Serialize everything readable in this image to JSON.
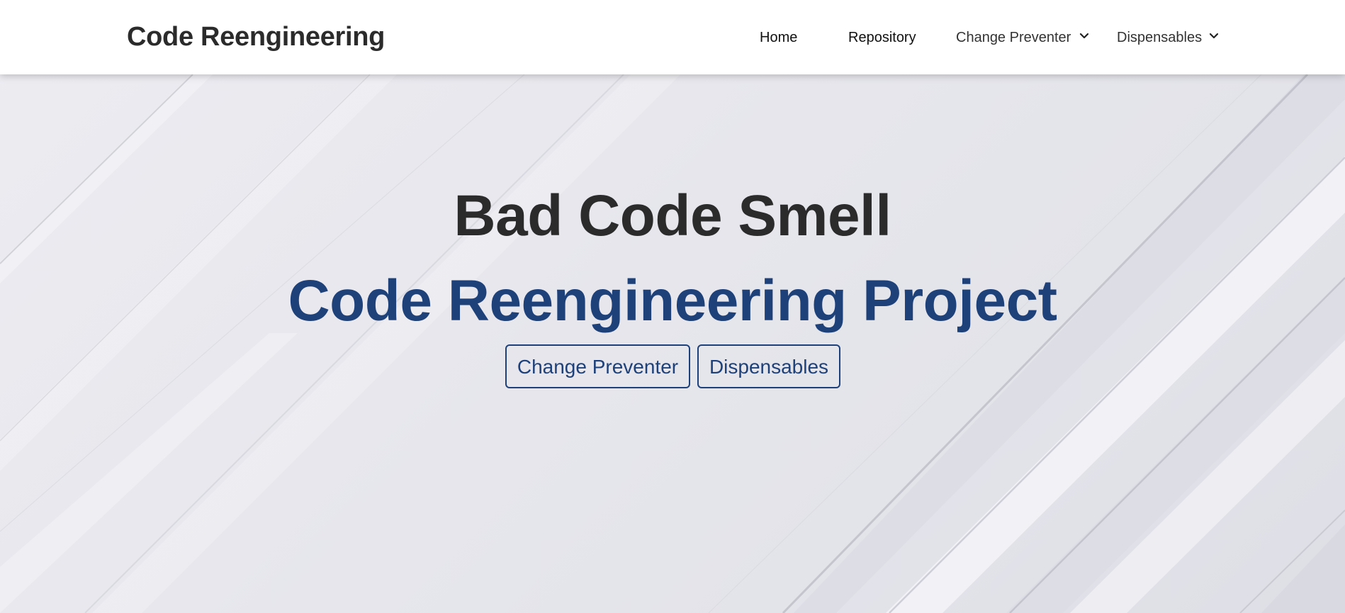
{
  "navbar": {
    "brand": "Code Reengineering",
    "items": [
      {
        "label": "Home"
      },
      {
        "label": "Repository"
      },
      {
        "label": "Change Preventer",
        "icon": "chevron-down-icon"
      },
      {
        "label": "Dispensables",
        "icon": "chevron-down-icon"
      }
    ]
  },
  "hero": {
    "title": "Bad Code Smell",
    "subtitle": "Code Reengineering Project",
    "buttons": [
      {
        "label": "Change Preventer"
      },
      {
        "label": "Dispensables"
      }
    ]
  },
  "colors": {
    "accent": "#1e4179",
    "heading": "#2b2b2b",
    "background": "#e6e6ec",
    "navbar": "#ffffff"
  }
}
